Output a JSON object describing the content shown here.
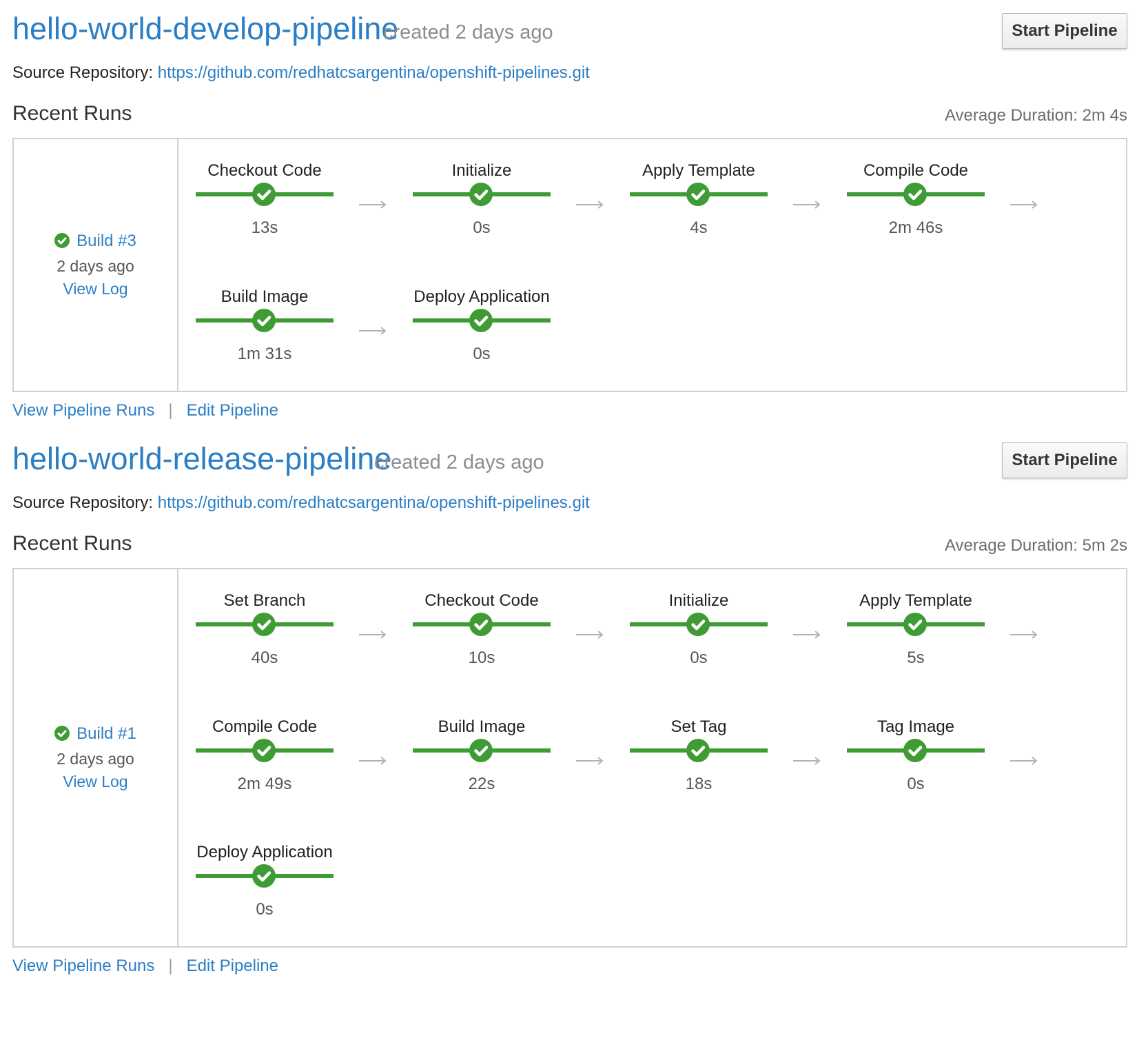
{
  "pipelines": [
    {
      "name": "hello-world-develop-pipeline",
      "created": "created 2 days ago",
      "start_label": "Start Pipeline",
      "source_label": "Source Repository:",
      "source_url": "https://github.com/redhatcsargentina/openshift-pipelines.git",
      "recent_runs_label": "Recent Runs",
      "average_duration": "Average Duration: 2m 4s",
      "build": {
        "label": "Build #3",
        "date": "2 days ago",
        "view_log": "View Log",
        "status": "success"
      },
      "stages": [
        {
          "name": "Checkout Code",
          "duration": "13s",
          "status": "success"
        },
        {
          "name": "Initialize",
          "duration": "0s",
          "status": "success"
        },
        {
          "name": "Apply Template",
          "duration": "4s",
          "status": "success"
        },
        {
          "name": "Compile Code",
          "duration": "2m 46s",
          "status": "success"
        },
        {
          "name": "Build Image",
          "duration": "1m 31s",
          "status": "success"
        },
        {
          "name": "Deploy Application",
          "duration": "0s",
          "status": "success"
        }
      ],
      "view_runs_label": "View Pipeline Runs",
      "edit_label": "Edit Pipeline",
      "separator": "|"
    },
    {
      "name": "hello-world-release-pipeline",
      "created": "created 2 days ago",
      "start_label": "Start Pipeline",
      "source_label": "Source Repository:",
      "source_url": "https://github.com/redhatcsargentina/openshift-pipelines.git",
      "recent_runs_label": "Recent Runs",
      "average_duration": "Average Duration: 5m 2s",
      "build": {
        "label": "Build #1",
        "date": "2 days ago",
        "view_log": "View Log",
        "status": "success"
      },
      "stages": [
        {
          "name": "Set Branch",
          "duration": "40s",
          "status": "success"
        },
        {
          "name": "Checkout Code",
          "duration": "10s",
          "status": "success"
        },
        {
          "name": "Initialize",
          "duration": "0s",
          "status": "success"
        },
        {
          "name": "Apply Template",
          "duration": "5s",
          "status": "success"
        },
        {
          "name": "Compile Code",
          "duration": "2m 49s",
          "status": "success"
        },
        {
          "name": "Build Image",
          "duration": "22s",
          "status": "success"
        },
        {
          "name": "Set Tag",
          "duration": "18s",
          "status": "success"
        },
        {
          "name": "Tag Image",
          "duration": "0s",
          "status": "success"
        },
        {
          "name": "Deploy Application",
          "duration": "0s",
          "status": "success"
        }
      ],
      "view_runs_label": "View Pipeline Runs",
      "edit_label": "Edit Pipeline",
      "separator": "|"
    }
  ],
  "colors": {
    "link": "#2a7ec6",
    "success": "#3f9c35",
    "muted": "#8b8d8f",
    "border": "#d1d1d1"
  },
  "icons": {
    "stage_status": "check-circle-icon",
    "connector": "arrow-right-icon"
  }
}
